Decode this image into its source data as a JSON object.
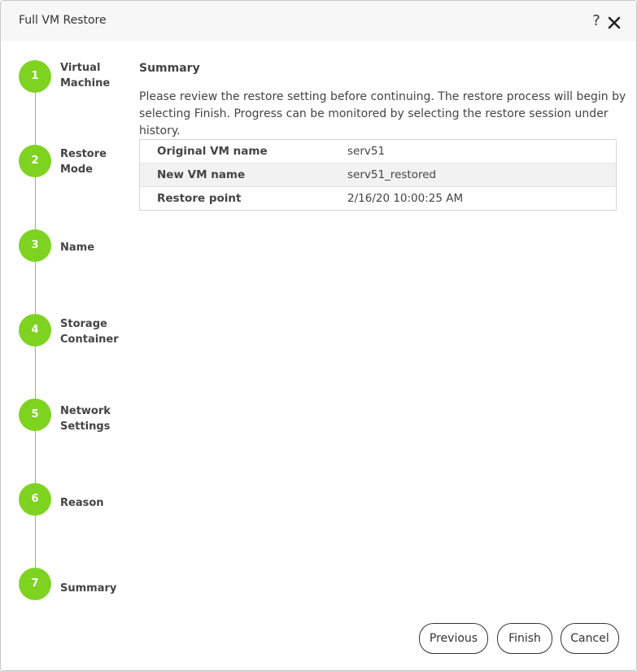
{
  "window": {
    "title": "Full VM Restore",
    "help_label": "?"
  },
  "steps": [
    {
      "number": "1",
      "label": "Virtual\nMachine"
    },
    {
      "number": "2",
      "label": "Restore\nMode"
    },
    {
      "number": "3",
      "label": "Name"
    },
    {
      "number": "4",
      "label": "Storage\nContainer"
    },
    {
      "number": "5",
      "label": "Network\nSettings"
    },
    {
      "number": "6",
      "label": "Reason"
    },
    {
      "number": "7",
      "label": "Summary"
    }
  ],
  "main": {
    "section_title": "Summary",
    "description": "Please review the restore setting before continuing. The restore process will begin by selecting Finish. Progress can be monitored by selecting the restore session under history.",
    "table": {
      "rows": [
        {
          "key": "Original VM name",
          "value": "serv51"
        },
        {
          "key": "New VM name",
          "value": "serv51_restored"
        },
        {
          "key": "Restore point",
          "value": "2/16/20 10:00:25 AM"
        }
      ]
    }
  },
  "footer": {
    "previous_label": "Previous",
    "finish_label": "Finish",
    "cancel_label": "Cancel"
  },
  "colors": {
    "step_accent": "#7ed321",
    "titlebar_bg": "#f7f7f7"
  }
}
